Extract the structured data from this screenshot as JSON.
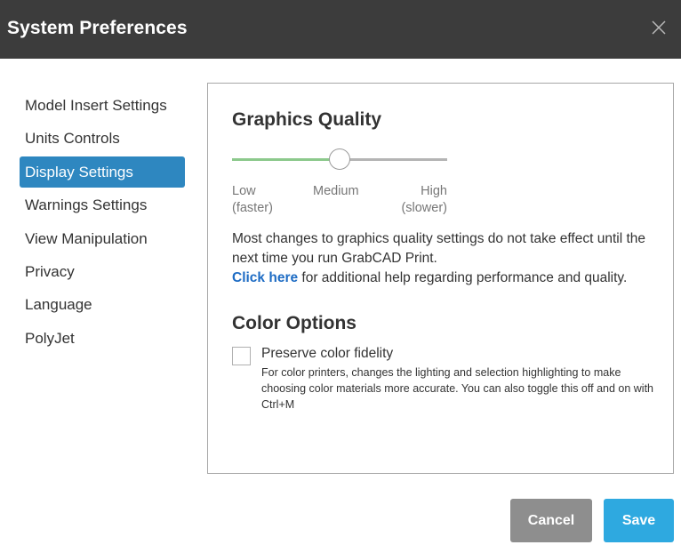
{
  "window": {
    "title": "System Preferences",
    "close_icon": "close-icon"
  },
  "sidebar": {
    "active_index": 2,
    "items": [
      {
        "label": "Model Insert Settings"
      },
      {
        "label": "Units Controls"
      },
      {
        "label": "Display Settings"
      },
      {
        "label": "Warnings Settings"
      },
      {
        "label": "View Manipulation"
      },
      {
        "label": "Privacy"
      },
      {
        "label": "Language"
      },
      {
        "label": "PolyJet"
      }
    ]
  },
  "graphics": {
    "title": "Graphics Quality",
    "slider": {
      "value": 0.5,
      "levels": [
        {
          "label": "Low",
          "sublabel": "(faster)"
        },
        {
          "label": "Medium",
          "sublabel": ""
        },
        {
          "label": "High",
          "sublabel": "(slower)"
        }
      ]
    },
    "description": "Most changes to graphics quality settings do not take effect until the next time you run GrabCAD Print.",
    "help_link": "Click here",
    "help_text": " for additional help regarding performance and quality."
  },
  "color_options": {
    "title": "Color Options",
    "checkbox_label": "Preserve color fidelity",
    "checked": false,
    "checkbox_description": "For color printers, changes the lighting and selection highlighting to make choosing color materials more accurate. You can also toggle this off and on with Ctrl+M"
  },
  "buttons": {
    "cancel": "Cancel",
    "save": "Save"
  },
  "colors": {
    "titlebar": "#3c3c3c",
    "active_item": "#2e87c0",
    "link": "#1e6cc4",
    "slider_fill": "#8cc98c",
    "cancel_button": "#8e8e8e",
    "save_button": "#2ea9e0"
  }
}
